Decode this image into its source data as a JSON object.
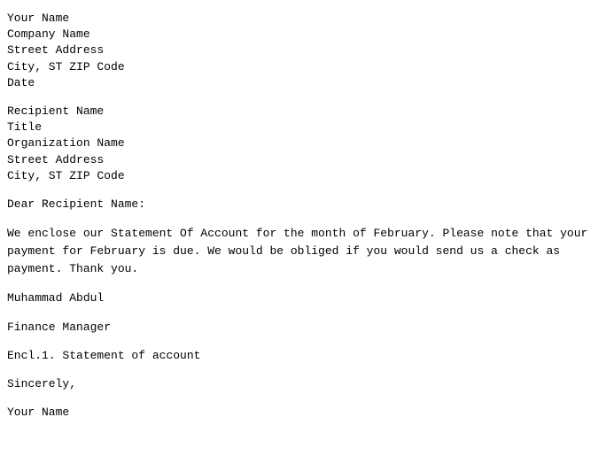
{
  "letter": {
    "sender": {
      "name": "Your Name",
      "company": "Company Name",
      "street": "Street Address",
      "city": "City, ST ZIP Code",
      "date": "Date"
    },
    "recipient": {
      "name": "Recipient Name",
      "title": "Title",
      "organization": "Organization Name",
      "street": "Street Address",
      "city": "City, ST ZIP Code"
    },
    "salutation": "Dear Recipient Name:",
    "body": "We enclose our Statement Of Account for the month of February. Please note that your payment for February is due. We would be obliged if you would send us a check as payment. Thank you.",
    "sender_name": "Muhammad Abdul",
    "sender_title": "Finance Manager",
    "enclosure": "Encl.1. Statement of account",
    "closing": "Sincerely,",
    "closing_name": "Your Name"
  }
}
